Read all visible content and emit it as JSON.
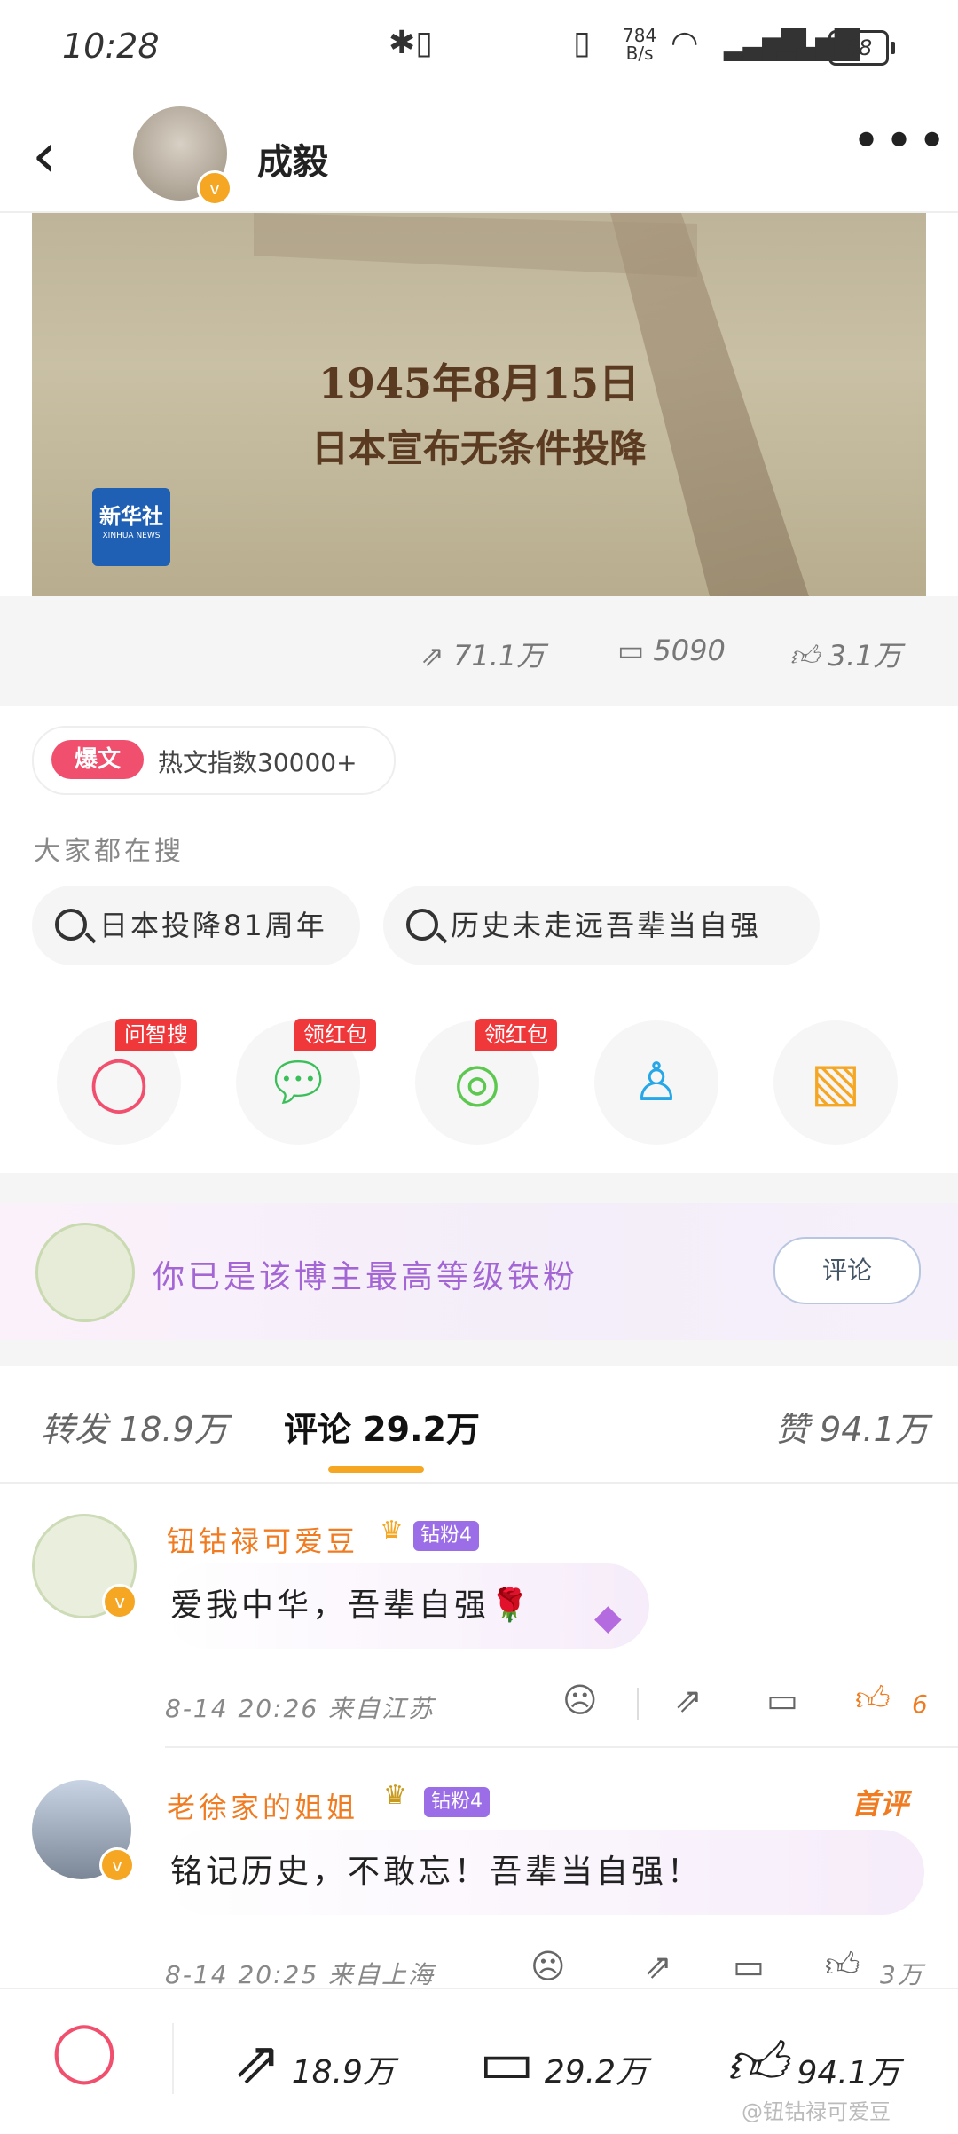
{
  "status_bar": {
    "time": "10:28",
    "net_speed_value": "784",
    "net_speed_unit": "B/s",
    "battery": "68"
  },
  "header": {
    "author": "成毅"
  },
  "banner": {
    "line1": "1945年8月15日",
    "line2": "日本宣布无条件投降",
    "logo_text": "新华社",
    "logo_sub": "XINHUA NEWS"
  },
  "post_stats": {
    "reposts": "71.1万",
    "comments": "5090",
    "likes": "3.1万"
  },
  "hot": {
    "badge": "爆文",
    "text": "热文指数30000+"
  },
  "searches": {
    "title": "大家都在搜",
    "items": [
      "日本投降81周年",
      "历史未走远吾辈当自强"
    ]
  },
  "share_tags": [
    "问智搜",
    "领红包",
    "领红包"
  ],
  "iron_fan": {
    "text": "你已是该博主最高等级铁粉",
    "button": "评论"
  },
  "tabs": {
    "repost": "转发 18.9万",
    "comment": "评论 29.2万",
    "like": "赞 94.1万"
  },
  "comments": [
    {
      "name": "钮钴禄可爱豆",
      "badge": "钻粉4",
      "text": "爱我中华，吾辈自强🌹",
      "time": "8-14 20:26",
      "location": "来自江苏",
      "likes": "6"
    },
    {
      "name": "老徐家的姐姐",
      "badge": "钻粉4",
      "text": "铭记历史，不敢忘！吾辈当自强！",
      "time": "8-14 20:25",
      "location": "来自上海",
      "likes": "3万",
      "tag": "首评"
    }
  ],
  "bottom_bar": {
    "reposts": "18.9万",
    "comments": "29.2万",
    "likes": "94.1万"
  },
  "watermark": "@钮钴禄可爱豆",
  "colors": {
    "accent": "#f5a623",
    "brand_red": "#f0506e",
    "name_orange": "#f07b20",
    "fan_purple": "#a366d4"
  }
}
